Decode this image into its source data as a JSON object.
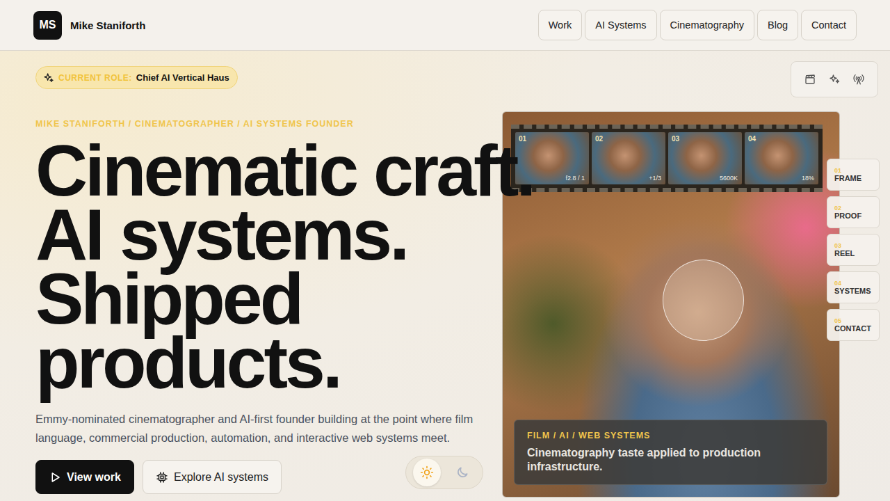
{
  "brand": {
    "initials": "MS",
    "name": "Mike Staniforth"
  },
  "nav": [
    {
      "label": "Work"
    },
    {
      "label": "AI Systems"
    },
    {
      "label": "Cinematography"
    },
    {
      "label": "Blog"
    },
    {
      "label": "Contact"
    }
  ],
  "role_badge": {
    "label": "CURRENT ROLE:",
    "value": "Chief AI Vertical Haus"
  },
  "eyebrow": "MIKE STANIFORTH / CINEMATOGRAPHER / AI SYSTEMS FOUNDER",
  "headline": [
    "Cinematic craft.",
    "AI systems.",
    "Shipped",
    "products."
  ],
  "intro": "Emmy-nominated cinematographer and AI-first founder building at the point where film language, commercial production, automation, and interactive web systems meet.",
  "actions": [
    {
      "label": "View work",
      "kind": "primary"
    },
    {
      "label": "Explore AI systems",
      "kind": "secondary"
    }
  ],
  "theme_toggle": [
    {
      "kind": "sun",
      "selected": true
    },
    {
      "kind": "moon",
      "selected": false
    }
  ],
  "filmstrip": [
    {
      "number": "01",
      "reading": "f2.8 / 1"
    },
    {
      "number": "02",
      "reading": "+1/3"
    },
    {
      "number": "03",
      "reading": "5600K"
    },
    {
      "number": "04",
      "reading": "18%"
    }
  ],
  "section_nav": [
    {
      "number": "01",
      "label": "FRAME"
    },
    {
      "number": "02",
      "label": "PROOF"
    },
    {
      "number": "03",
      "label": "REEL"
    },
    {
      "number": "04",
      "label": "SYSTEMS"
    },
    {
      "number": "05",
      "label": "CONTACT"
    }
  ],
  "caption": {
    "eyebrow": "FILM / AI / WEB SYSTEMS",
    "text": "Cinematography taste applied to production infrastructure."
  }
}
